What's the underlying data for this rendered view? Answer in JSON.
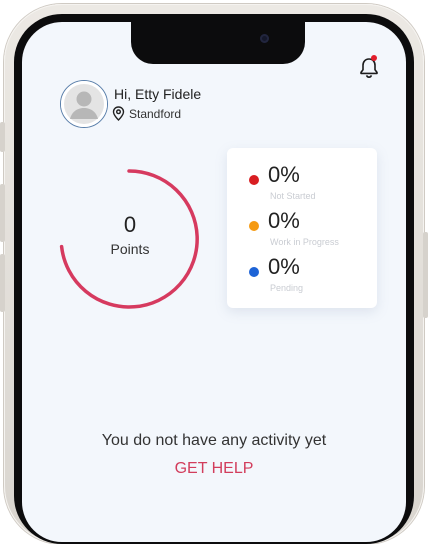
{
  "header": {
    "greeting": "Hi, Etty Fidele",
    "location": "Standford"
  },
  "points": {
    "value": "0",
    "label": "Points"
  },
  "stats": [
    {
      "value": "0%",
      "label": "Not Started",
      "color": "#d81e22"
    },
    {
      "value": "0%",
      "label": "Work in Progress",
      "color": "#f59a12"
    },
    {
      "value": "0%",
      "label": "Pending",
      "color": "#1d63d6"
    }
  ],
  "empty_state": {
    "message": "You do not have any activity yet",
    "help_link": "GET HELP"
  },
  "colors": {
    "accent": "#d23d5c",
    "screen_bg": "#f3f7fc",
    "notification_dot": "#e21d2b"
  },
  "icons": [
    "bell-icon",
    "avatar-icon",
    "location-pin-icon"
  ]
}
